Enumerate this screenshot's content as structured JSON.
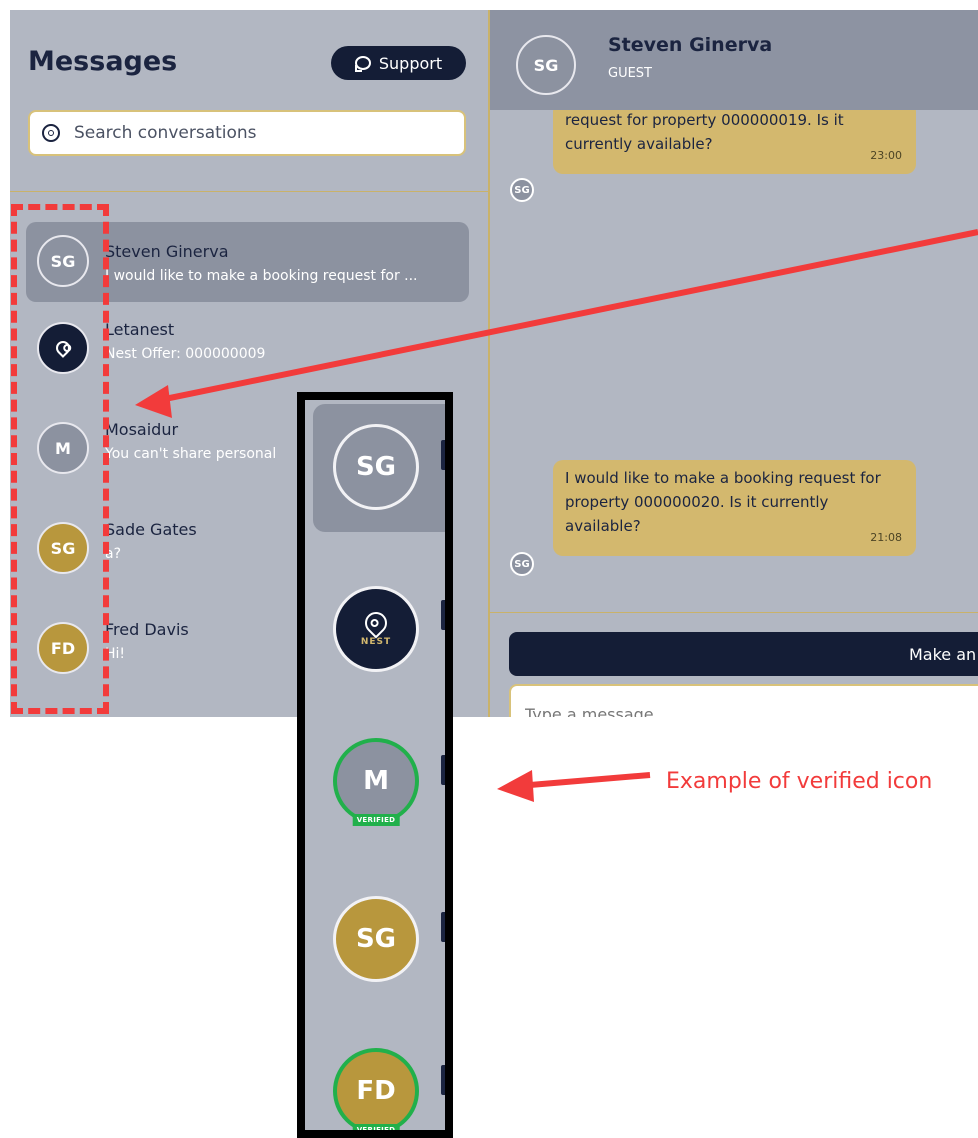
{
  "sidebar": {
    "title": "Messages",
    "support_label": "Support",
    "search_placeholder": "Search conversations",
    "conversations": [
      {
        "initials": "SG",
        "name": "Steven Ginerva",
        "preview": "I would like to make a booking request for ..."
      },
      {
        "initials": "NEST",
        "name": "Letanest",
        "preview": "Nest Offer: 000000009"
      },
      {
        "initials": "M",
        "name": "Mosaidur",
        "preview": "You can't share personal"
      },
      {
        "initials": "SG",
        "name": "Sade Gates",
        "preview": "a?"
      },
      {
        "initials": "FD",
        "name": "Fred Davis",
        "preview": "Hi!"
      }
    ]
  },
  "chat": {
    "header": {
      "initials": "SG",
      "name": "Steven Ginerva",
      "role": "GUEST"
    },
    "messages": [
      {
        "text": "request for property 000000019. Is it currently available?",
        "time": "23:00",
        "avatar": "SG"
      },
      {
        "text": "I would like to make a booking request for property 000000020. Is it currently available?",
        "time": "21:08",
        "avatar": "SG"
      }
    ],
    "offer_button": "Make an",
    "input_placeholder": "Type a message..."
  },
  "zoom_panel": {
    "avatars": [
      {
        "initials": "SG",
        "verified": false
      },
      {
        "initials": "NEST",
        "verified": false
      },
      {
        "initials": "M",
        "verified": true,
        "badge": "VERIFIED"
      },
      {
        "initials": "SG",
        "verified": false
      },
      {
        "initials": "FD",
        "verified": true,
        "badge": "VERIFIED"
      }
    ]
  },
  "annotation": {
    "label": "Example of verified icon",
    "color": "#f23b3b"
  },
  "colors": {
    "navy": "#141d36",
    "gold": "#b8973d",
    "bubble": "#d3b86e",
    "panel": "#b2b7c2",
    "verified": "#21b04b"
  }
}
